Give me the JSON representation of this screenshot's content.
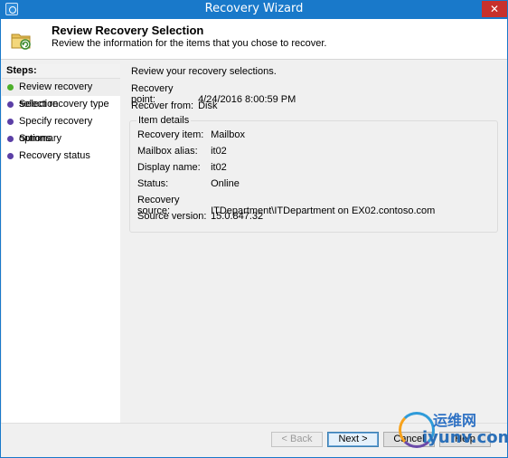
{
  "window": {
    "title": "Recovery Wizard",
    "close_glyph": "✕"
  },
  "header": {
    "title": "Review Recovery Selection",
    "subtitle": "Review the information for the items that you chose to recover.",
    "icon": "recovery-wizard-icon"
  },
  "steps": {
    "title": "Steps:",
    "items": [
      {
        "label": "Review recovery selection",
        "active": true
      },
      {
        "label": "Select recovery type",
        "active": false
      },
      {
        "label": "Specify recovery options",
        "active": false
      },
      {
        "label": "Summary",
        "active": false
      },
      {
        "label": "Recovery status",
        "active": false
      }
    ]
  },
  "content": {
    "intro": "Review your recovery selections.",
    "recovery_point_label": "Recovery point:",
    "recovery_point_value": "4/24/2016 8:00:59 PM",
    "recover_from_label": "Recover from:",
    "recover_from_value": "Disk",
    "item_details": {
      "title": "Item details",
      "rows": [
        {
          "label": "Recovery item:",
          "value": "Mailbox"
        },
        {
          "label": "Mailbox alias:",
          "value": "it02"
        },
        {
          "label": "Display name:",
          "value": "it02"
        },
        {
          "label": "Status:",
          "value": "Online"
        },
        {
          "label": "Recovery source:",
          "value": "ITDepartment\\ITDepartment on EX02.contoso.com"
        },
        {
          "label": "Source version:",
          "value": "15.0.847.32"
        }
      ]
    }
  },
  "footer": {
    "back_label": "< Back",
    "next_label": "Next >",
    "cancel_label": "Cancel",
    "help_label": "Help"
  },
  "watermark": {
    "cn_text": "运维网",
    "en_text": "iyunv.com"
  },
  "colors": {
    "titlebar": "#1979ca",
    "close": "#c7312c",
    "active_dot": "#4caf2a",
    "step_dot": "#5b3fa6"
  }
}
